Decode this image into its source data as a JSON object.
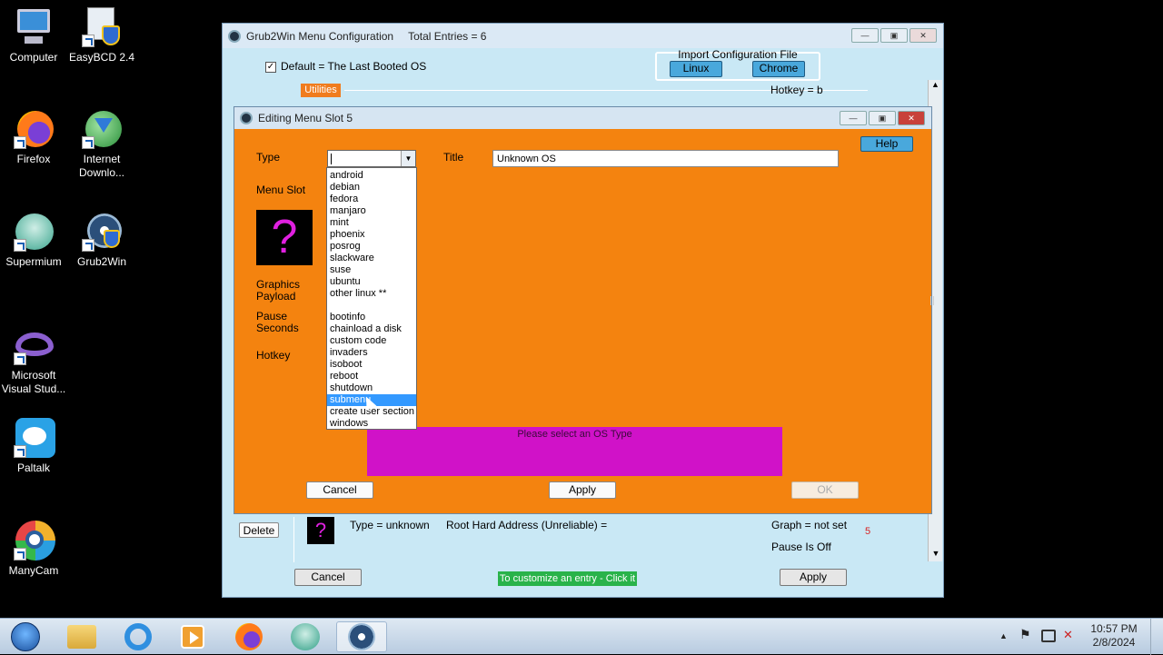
{
  "desktop": {
    "icons": [
      {
        "label": "Computer",
        "icon": "computer-icon"
      },
      {
        "label": "EasyBCD 2.4",
        "icon": "easybcd-icon"
      },
      {
        "label": "Firefox",
        "icon": "firefox-icon"
      },
      {
        "label": "Internet Downlo...",
        "icon": "internet-download-icon"
      },
      {
        "label": "Supermium",
        "icon": "supermium-icon"
      },
      {
        "label": "Grub2Win",
        "icon": "grub2win-icon"
      },
      {
        "label": "Microsoft Visual Stud...",
        "icon": "visual-studio-icon"
      },
      {
        "label": "Paltalk",
        "icon": "paltalk-icon"
      },
      {
        "label": "ManyCam",
        "icon": "manycam-icon"
      }
    ]
  },
  "main_window": {
    "title": "Grub2Win Menu Configuration",
    "total_entries": "Total Entries = 6",
    "default_checkbox": {
      "checked": true,
      "label": "Default = The Last Booted OS"
    },
    "import": {
      "legend": "Import Configuration File",
      "linux": "Linux",
      "chrome": "Chrome"
    },
    "utilities_tag": "Utilities",
    "hotkey": "Hotkey = b",
    "delete_button": "Delete",
    "entry": {
      "type": "Type = unknown",
      "root": "Root Hard Address (Unreliable) =",
      "graph": "Graph = not set",
      "pause": "Pause Is Off",
      "slot_number": "5"
    },
    "cancel": "Cancel",
    "customize": "To customize an entry - Click it",
    "apply": "Apply"
  },
  "dialog": {
    "title": "Editing Menu Slot 5",
    "help": "Help",
    "labels": {
      "type": "Type",
      "menu_slot": "Menu Slot",
      "graphics_payload_1": "Graphics",
      "graphics_payload_2": "Payload",
      "pause_1": "Pause",
      "pause_2": "Seconds",
      "hotkey": "Hotkey",
      "title": "Title"
    },
    "type_value": "",
    "title_value": "Unknown OS",
    "dropdown_group1": [
      "android",
      "debian",
      "fedora",
      "manjaro",
      "mint",
      "phoenix",
      "posrog",
      "slackware",
      "suse",
      "ubuntu",
      "other linux **"
    ],
    "dropdown_group2": [
      "bootinfo",
      "chainload a disk",
      "custom code",
      "invaders",
      "isoboot",
      "reboot",
      "shutdown",
      "submenu",
      "create user section",
      "windows"
    ],
    "selected_option": "submenu",
    "message": "Please select an OS Type",
    "cancel": "Cancel",
    "apply": "Apply",
    "ok": "OK",
    "icon_glyph": "?"
  },
  "taskbar": {
    "time": "10:57 PM",
    "date": "2/8/2024",
    "apps": [
      "start-orb-icon",
      "file-explorer-icon",
      "internet-explorer-icon",
      "media-player-icon",
      "firefox-icon",
      "supermium-icon",
      "grub2win-icon"
    ]
  }
}
